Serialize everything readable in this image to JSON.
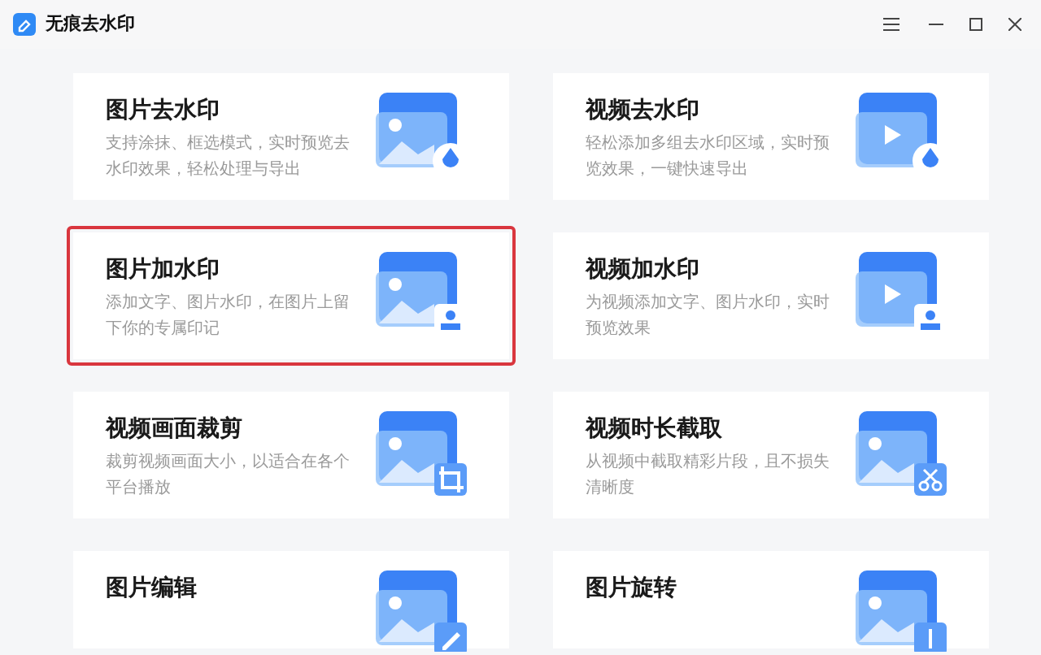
{
  "window": {
    "title": "无痕去水印"
  },
  "cards": [
    {
      "kind": "image-remove",
      "title": "图片去水印",
      "description": "支持涂抹、框选模式，实时预览去水印效果，轻松处理与导出",
      "selected": false
    },
    {
      "kind": "video-remove",
      "title": "视频去水印",
      "description": "轻松添加多组去水印区域，实时预览效果，一键快速导出",
      "selected": false
    },
    {
      "kind": "image-add",
      "title": "图片加水印",
      "description": "添加文字、图片水印，在图片上留下你的专属印记",
      "selected": true
    },
    {
      "kind": "video-add",
      "title": "视频加水印",
      "description": "为视频添加文字、图片水印，实时预览效果",
      "selected": false
    },
    {
      "kind": "video-crop",
      "title": "视频画面裁剪",
      "description": "裁剪视频画面大小，以适合在各个平台播放",
      "selected": false
    },
    {
      "kind": "video-trim",
      "title": "视频时长截取",
      "description": "从视频中截取精彩片段，且不损失清晰度",
      "selected": false
    },
    {
      "kind": "image-edit",
      "title": "图片编辑",
      "selected": false
    },
    {
      "kind": "image-rotate",
      "title": "图片旋转",
      "selected": false
    }
  ]
}
